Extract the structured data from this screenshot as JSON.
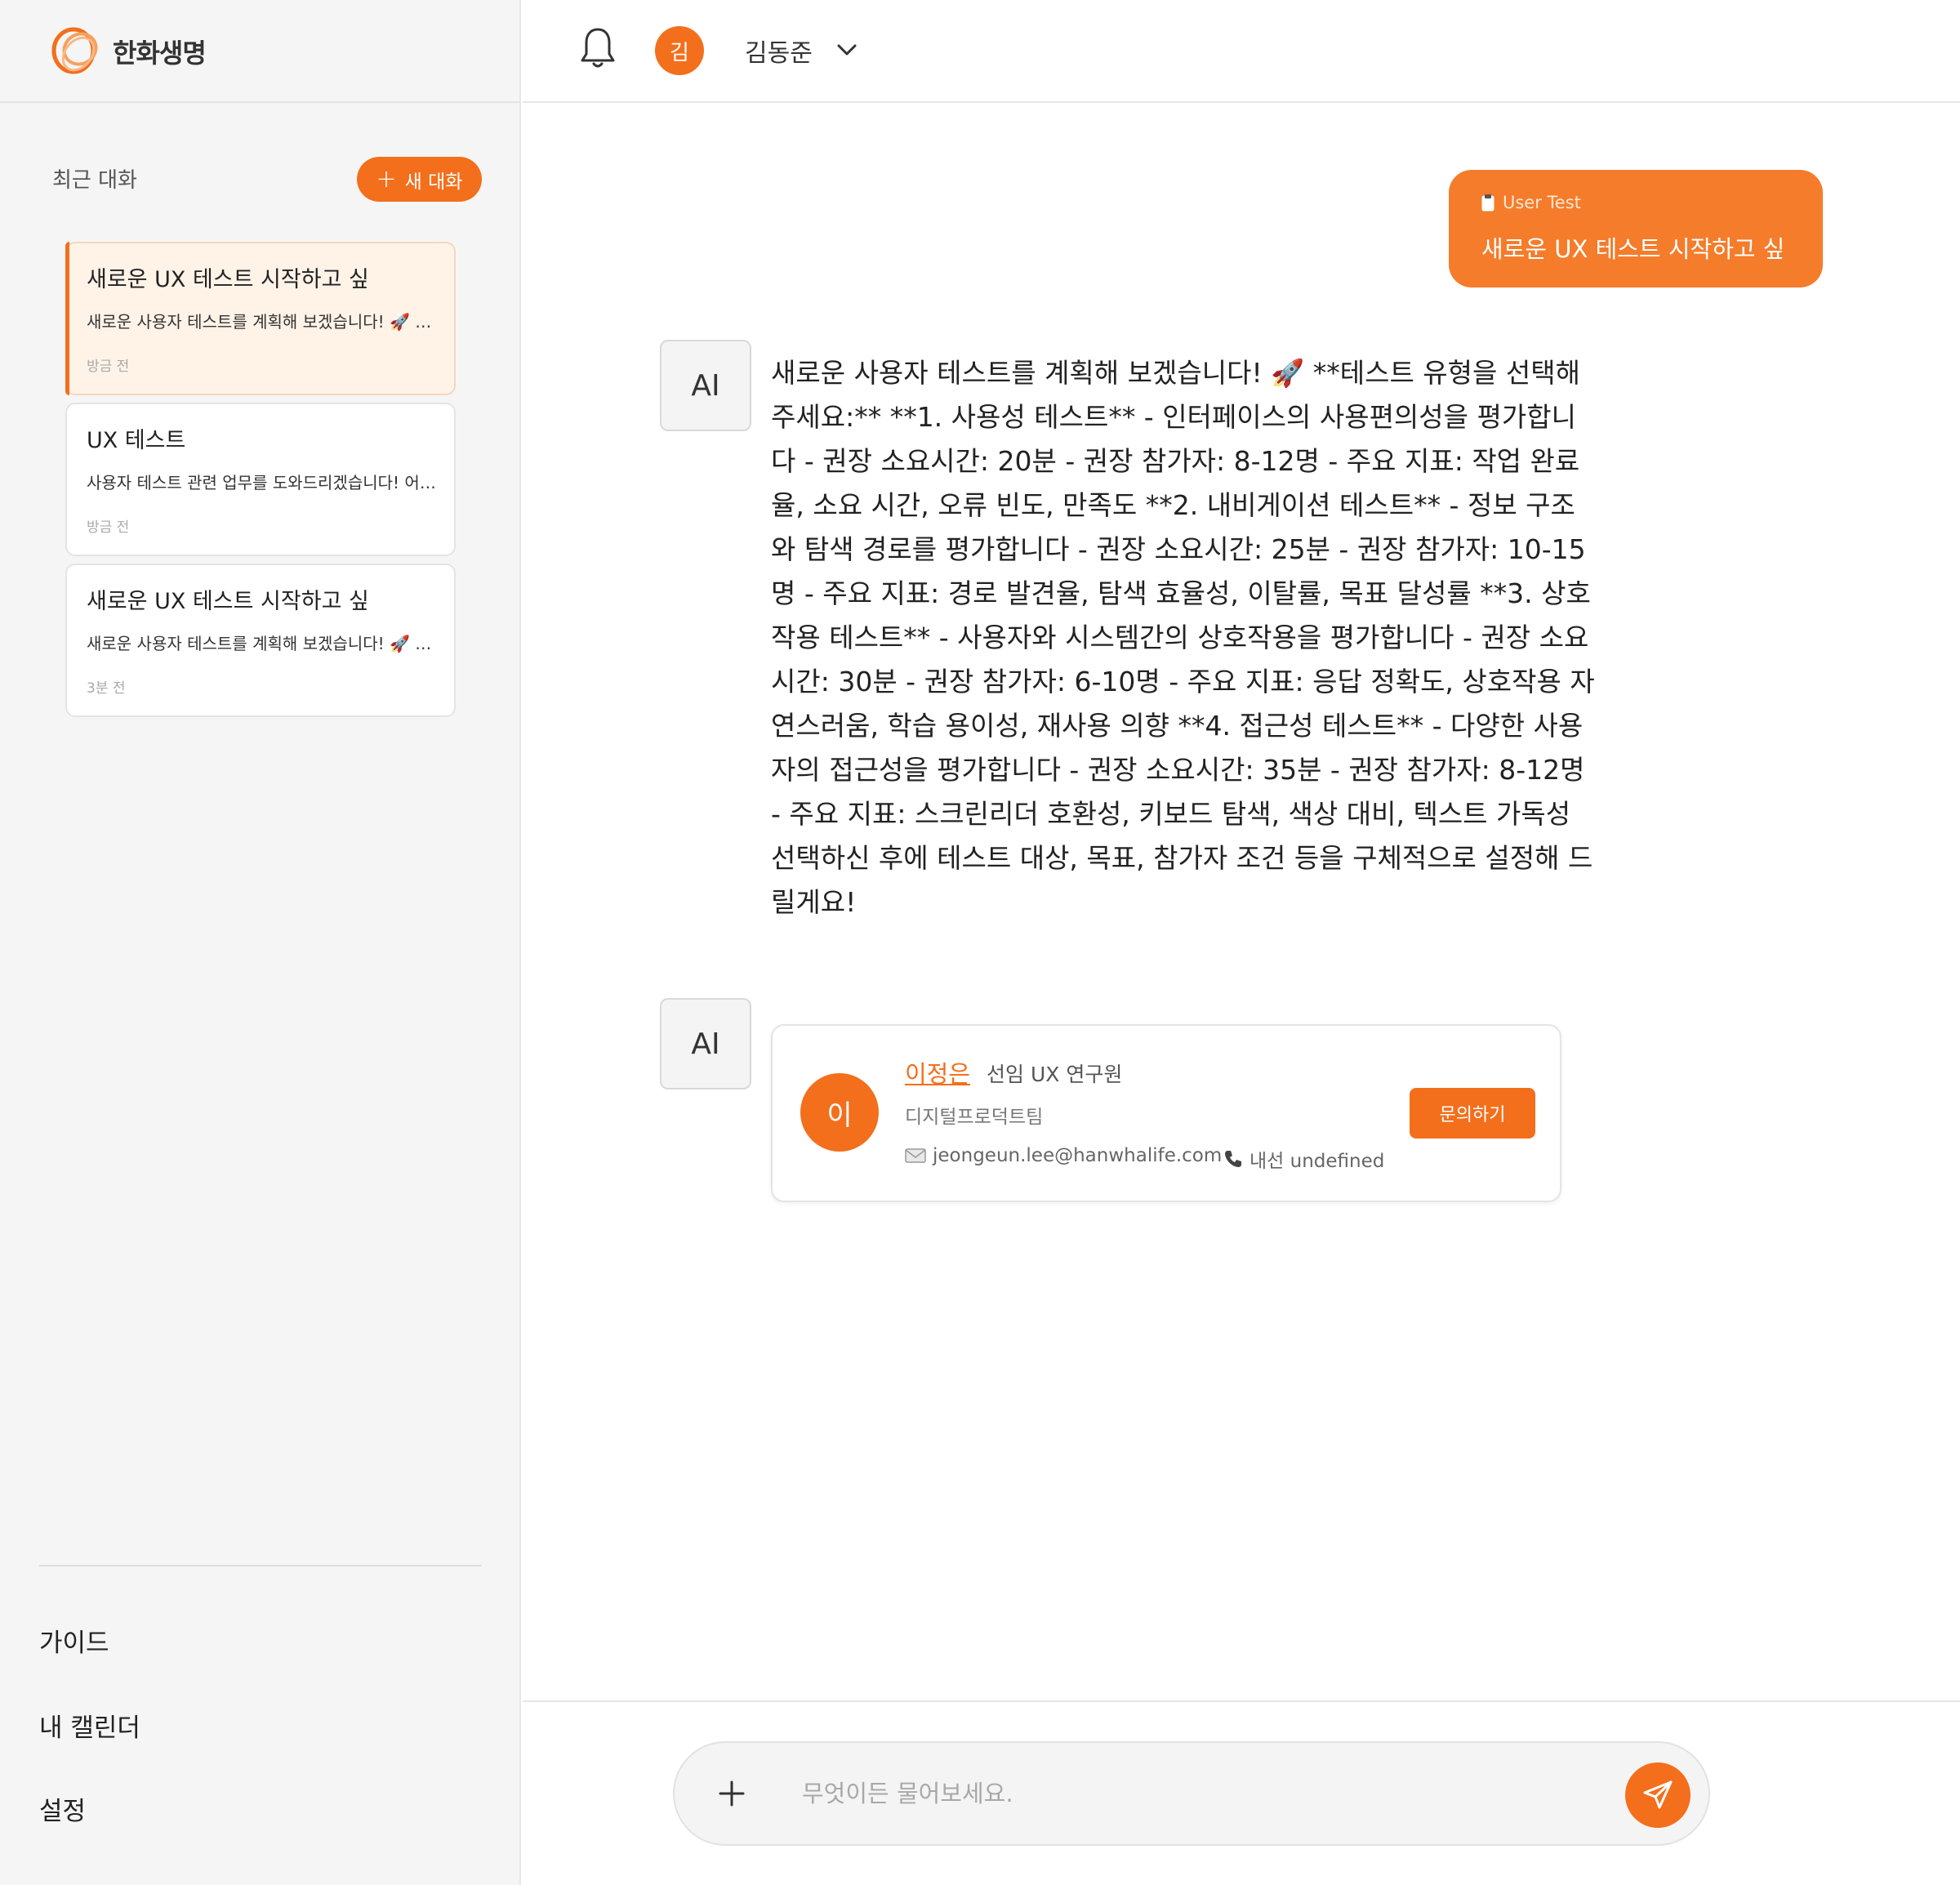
{
  "brand": {
    "name": "한화생명",
    "accent": "#f36f1c"
  },
  "header": {
    "bell_icon": "bell-icon",
    "avatar_initial": "김",
    "user_name": "김동준",
    "dropdown_icon": "chevron-down-icon"
  },
  "sidebar": {
    "recent_title": "최근 대화",
    "new_chat_label": "새 대화",
    "conversations": [
      {
        "title": "새로운 UX 테스트 시작하고 싶",
        "preview": "새로운 사용자 테스트를 계획해 보겠습니다! 🚀 **테스트 유형을 선택해 주세요:**",
        "time": "방금 전",
        "active": true
      },
      {
        "title": "UX 테스트",
        "preview": "사용자 테스트 관련 업무를 도와드리겠습니다! 어떤 테스트를 진행하시겠어요?",
        "time": "방금 전",
        "active": false
      },
      {
        "title": "새로운 UX 테스트 시작하고 싶",
        "preview": "새로운 사용자 테스트를 계획해 보겠습니다! 🚀 **테스트 유형을 선택해 주세요:**",
        "time": "3분 전",
        "active": false
      }
    ],
    "links": [
      "가이드",
      "내 캘린더",
      "설정"
    ]
  },
  "chat": {
    "user_message": {
      "tag": "User Test",
      "text": "새로운 UX 테스트 시작하고 싶"
    },
    "ai_label": "AI",
    "ai_message": "새로운 사용자 테스트를 계획해 보겠습니다! 🚀 **테스트 유형을 선택해 주세요:** **1. 사용성 테스트** - 인터페이스의 사용편의성을 평가합니다 - 권장 소요시간: 20분 - 권장 참가자: 8-12명 - 주요 지표: 작업 완료율, 소요 시간, 오류 빈도, 만족도 **2. 내비게이션 테스트** - 정보 구조와 탐색 경로를 평가합니다 - 권장 소요시간: 25분 - 권장 참가자: 10-15명 - 주요 지표: 경로 발견율, 탐색 효율성, 이탈률, 목표 달성률 **3. 상호작용 테스트** - 사용자와 시스템간의 상호작용을 평가합니다 - 권장 소요시간: 30분 - 권장 참가자: 6-10명 - 주요 지표: 응답 정확도, 상호작용 자연스러움, 학습 용이성, 재사용 의향 **4. 접근성 테스트** - 다양한 사용자의 접근성을 평가합니다 - 권장 소요시간: 35분 - 권장 참가자: 8-12명 - 주요 지표: 스크린리더 호환성, 키보드 탐색, 색상 대비, 텍스트 가독성 선택하신 후에 테스트 대상, 목표, 참가자 조건 등을 구체적으로 설정해 드릴게요!",
    "contact": {
      "avatar_initial": "이",
      "name": "이정은",
      "role": "선임 UX 연구원",
      "team": "디지털프로덕트팀",
      "email": "jeongeun.lee@hanwhalife.com",
      "extension": "내선 undefined",
      "inquiry_label": "문의하기"
    }
  },
  "input": {
    "placeholder": "무엇이든 물어보세요.",
    "value": "",
    "attach_icon": "plus-icon",
    "send_icon": "send-icon"
  }
}
